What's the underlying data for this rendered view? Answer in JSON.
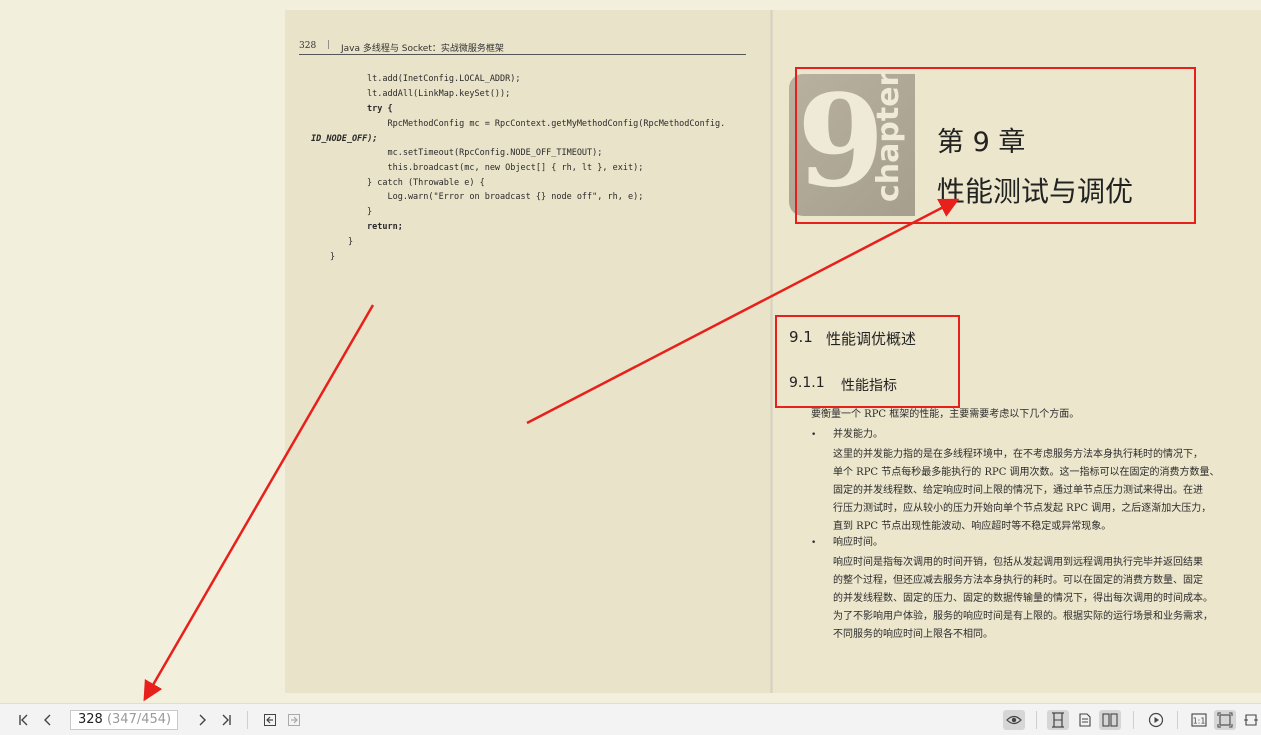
{
  "left_page": {
    "page_number": "328",
    "header_title": "Java 多线程与 Socket：实战微服务框架",
    "code_lines": [
      "lt.add(InetConfig.LOCAL_ADDR);",
      "lt.addAll(LinkMap.keySet());",
      "try {",
      "    RpcMethodConfig mc = RpcContext.getMyMethodConfig(RpcMethodConfig.",
      "ID_NODE_OFF);",
      "    mc.setTimeout(RpcConfig.NODE_OFF_TIMEOUT);",
      "    this.broadcast(mc, new Object[] { rh, lt }, exit);",
      "} catch (Throwable e) {",
      "    Log.warn(\"Error on broadcast {} node off\", rh, e);",
      "}",
      "return;",
      "}",
      "}"
    ]
  },
  "right_page": {
    "chapter_number": "9",
    "chapter_word": "chapter",
    "chapter_label": "第 9 章",
    "chapter_title": "性能测试与调优",
    "section_number": "9.1",
    "section_title": "性能调优概述",
    "subsection_number": "9.1.1",
    "subsection_title": "性能指标",
    "intro": "要衡量一个 RPC 框架的性能，主要需要考虑以下几个方面。",
    "bullets": [
      {
        "title": "并发能力。",
        "lines": [
          "这里的并发能力指的是在多线程环境中，在不考虑服务方法本身执行耗时的情况下，",
          "单个 RPC 节点每秒最多能执行的 RPC 调用次数。这一指标可以在固定的消费方数量、",
          "固定的并发线程数、给定响应时间上限的情况下，通过单节点压力测试来得出。在进",
          "行压力测试时，应从较小的压力开始向单个节点发起 RPC 调用，之后逐渐加大压力，",
          "直到 RPC 节点出现性能波动、响应超时等不稳定或异常现象。"
        ]
      },
      {
        "title": "响应时间。",
        "lines": [
          "响应时间是指每次调用的时间开销，包括从发起调用到远程调用执行完毕并返回结果",
          "的整个过程，但还应减去服务方法本身执行的耗时。可以在固定的消费方数量、固定",
          "的并发线程数、固定的压力、固定的数据传输量的情况下，得出每次调用的时间成本。",
          "为了不影响用户体验，服务的响应时间是有上限的。根据实际的运行场景和业务需求，",
          "不同服务的响应时间上限各不相同。"
        ]
      }
    ]
  },
  "toolbar": {
    "page_value": "328",
    "page_position": "(347/454)",
    "icons": [
      "first-page-icon",
      "prev-page-icon",
      "next-page-icon",
      "last-page-icon",
      "back-icon",
      "forward-icon",
      "eye-icon",
      "single-page-icon",
      "scroll-page-icon",
      "double-page-icon",
      "play-icon",
      "actual-size-icon",
      "fit-page-icon",
      "fit-width-icon"
    ]
  },
  "colors": {
    "annotation_red": "#e8201c",
    "page_bg": "#e9e3c9",
    "viewer_bg": "#f2efdc"
  }
}
